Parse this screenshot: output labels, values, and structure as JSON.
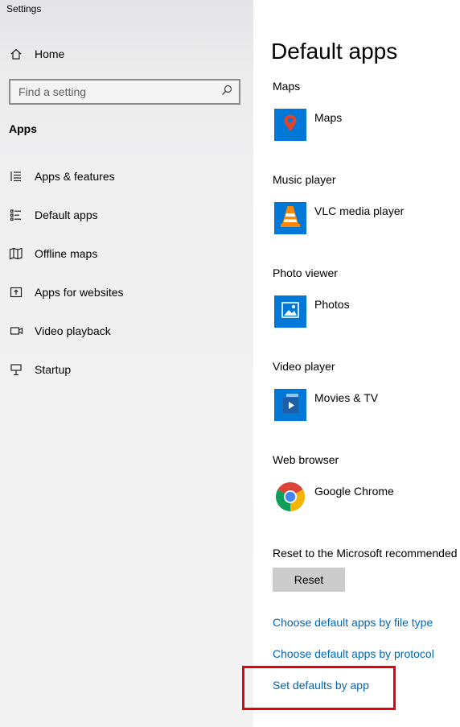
{
  "window": {
    "title": "Settings"
  },
  "sidebar": {
    "home": {
      "label": "Home",
      "icon": "home-icon"
    },
    "search": {
      "placeholder": "Find a setting",
      "icon": "search-icon"
    },
    "section": "Apps",
    "items": [
      {
        "label": "Apps & features",
        "icon": "apps-features-icon"
      },
      {
        "label": "Default apps",
        "icon": "default-apps-icon"
      },
      {
        "label": "Offline maps",
        "icon": "offline-maps-icon"
      },
      {
        "label": "Apps for websites",
        "icon": "apps-for-websites-icon"
      },
      {
        "label": "Video playback",
        "icon": "video-playback-icon"
      },
      {
        "label": "Startup",
        "icon": "startup-icon"
      }
    ]
  },
  "main": {
    "title": "Default apps",
    "categories": [
      {
        "label": "Maps",
        "app": "Maps",
        "icon": "maps-pin-icon",
        "tile_color": "#0078d7"
      },
      {
        "label": "Music player",
        "app": "VLC media player",
        "icon": "vlc-cone-icon",
        "tile_color": "#0078d7"
      },
      {
        "label": "Photo viewer",
        "app": "Photos",
        "icon": "photos-icon",
        "tile_color": "#0078d7"
      },
      {
        "label": "Video player",
        "app": "Movies & TV",
        "icon": "movies-tv-icon",
        "tile_color": "#0078d7"
      },
      {
        "label": "Web browser",
        "app": "Google Chrome",
        "icon": "chrome-icon",
        "tile_color": "#ffffff"
      }
    ],
    "reset": {
      "label": "Reset to the Microsoft recommended",
      "button": "Reset"
    },
    "links": [
      "Choose default apps by file type",
      "Choose default apps by protocol",
      "Set defaults by app"
    ]
  },
  "colors": {
    "link": "#0067b8",
    "highlight_border": "#e8000b",
    "reset_button_bg": "#cccccc",
    "tile_accent": "#0078d7"
  }
}
